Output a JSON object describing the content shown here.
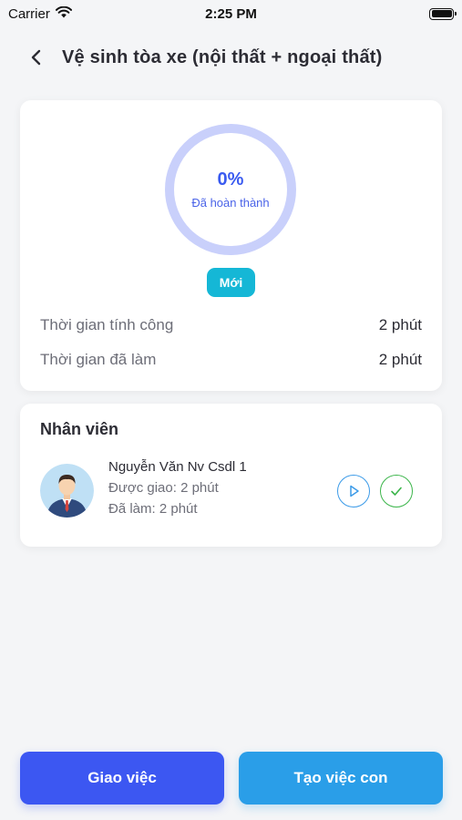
{
  "status_bar": {
    "carrier": "Carrier",
    "time": "2:25 PM"
  },
  "header": {
    "title": "Vệ sinh tòa xe (nội thất + ngoại thất)"
  },
  "progress": {
    "percent": "0%",
    "percent_value": 0,
    "label": "Đã hoàn thành",
    "status": "Mới",
    "ring_color": "#c9d0fb",
    "rows": [
      {
        "label": "Thời gian tính công",
        "value": "2 phút"
      },
      {
        "label": "Thời gian đã làm",
        "value": "2 phút"
      }
    ]
  },
  "staff": {
    "heading": "Nhân viên",
    "name": "Nguyễn Văn Nv Csdl 1",
    "assigned": "Được giao: 2 phút",
    "done": "Đã làm: 2 phút"
  },
  "actions": {
    "assign": "Giao việc",
    "create_sub": "Tạo việc con"
  },
  "colors": {
    "primary": "#3c57f2",
    "secondary": "#2a9ee8",
    "badge": "#15b7d6",
    "play": "#3c9be8",
    "check": "#3bb54a"
  }
}
